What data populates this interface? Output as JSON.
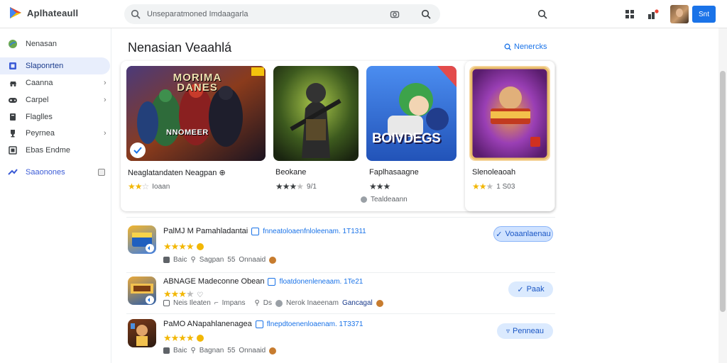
{
  "app": {
    "name": "Aplhateaull"
  },
  "search": {
    "value": "Unseparatmoned Imdaagarla",
    "placeholder": ""
  },
  "header": {
    "sign_in_label": "Snt"
  },
  "sidebar": {
    "items": [
      {
        "icon": "planet-icon",
        "label": "Nenasan",
        "chevron": ""
      },
      {
        "icon": "apps-icon",
        "label": "Slaponrten",
        "chevron": ""
      },
      {
        "icon": "car-icon",
        "label": "Caanna",
        "chevron": "›"
      },
      {
        "icon": "gamepad-icon",
        "label": "Carpel",
        "chevron": "›"
      },
      {
        "icon": "book-icon",
        "label": "Flaglles",
        "chevron": ""
      },
      {
        "icon": "trophy-icon",
        "label": "Peyrnea",
        "chevron": "›"
      },
      {
        "icon": "grid-icon",
        "label": "Ebas Endme",
        "chevron": ""
      },
      {
        "icon": "tag-icon",
        "label": "Saaonones",
        "chevron": ""
      }
    ]
  },
  "section": {
    "title": "Nenasian Veaahlá",
    "more_label": "Nenercks"
  },
  "featured": [
    {
      "name": "Neaglatandaten Neagpan ⊕",
      "rating_value": "Ioaan",
      "poster_text": "NNOMEER",
      "banner": "MORIMA DANES"
    },
    {
      "name": "Beokane",
      "rating_value": "9/1",
      "poster_text": "",
      "banner": ""
    },
    {
      "name": "Faplhasaagne",
      "rating_value": "Tealdeaann",
      "poster_text": "BOIVDEGS",
      "banner": ""
    },
    {
      "name": "Slenoleaoah",
      "rating_value": "1 S03",
      "poster_text": "",
      "banner": ""
    }
  ],
  "list": [
    {
      "title": "PalMJ M Pamahladantai",
      "subtitle": "fnneatoloaenfnloleenam. 1T1311",
      "meta": [
        "Baic",
        "Sagpan",
        "55",
        "Onnaaid"
      ],
      "action": "Voaanlaenau"
    },
    {
      "title": "ABNAGE Madeconne Obean",
      "subtitle": "floatdonenleneaam. 1Te21",
      "meta": [
        "Neis Ileaten",
        "Impans",
        "Ds",
        "Nerok Inaeenam",
        "Gancagal"
      ],
      "action": "Paak"
    },
    {
      "title": "PaMO ANapahlanenagea",
      "subtitle": "flnepdtoenenloaenam. 1T3371",
      "meta": [
        "Baic",
        "Bagnan",
        "55",
        "Onnaaid"
      ],
      "action": "Penneau"
    }
  ],
  "colors": {
    "accent": "#1a73e8",
    "star": "#f2b705"
  }
}
